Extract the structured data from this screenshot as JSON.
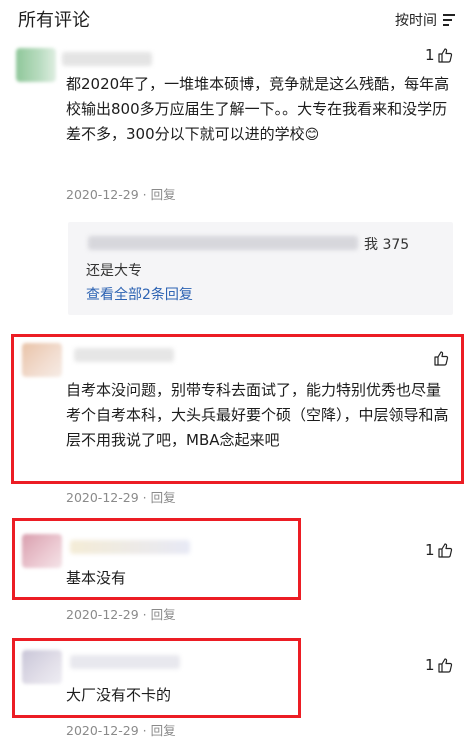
{
  "header": {
    "title": "所有评论",
    "sort_label": "按时间"
  },
  "comments": [
    {
      "likes": "1",
      "text": "都2020年了，一堆堆本硕博，竞争就是这么残酷，每年高校输出800多万应届生了解一下。。大专在我看来和没学历差不多，300分以下就可以进的学校",
      "emoji": "😊",
      "date": "2020-12-29",
      "reply_label": "回复",
      "replies": {
        "snippet_suffix": "我 375",
        "text": "还是大专",
        "view_all": "查看全部2条回复"
      }
    },
    {
      "likes": "",
      "text": "自考本没问题，别带专科去面试了，能力特别优秀也尽量考个自考本科，大头兵最好要个硕（空降），中层领导和高层不用我说了吧，MBA念起来吧",
      "date": "2020-12-29",
      "reply_label": "回复"
    },
    {
      "likes": "1",
      "text": "基本没有",
      "date": "2020-12-29",
      "reply_label": "回复"
    },
    {
      "likes": "1",
      "text": "大厂没有不卡的",
      "date": "2020-12-29",
      "reply_label": "回复"
    }
  ],
  "colors": {
    "highlight": "#ec1d24",
    "link": "#2d63b3",
    "meta": "#8a8a8a"
  }
}
